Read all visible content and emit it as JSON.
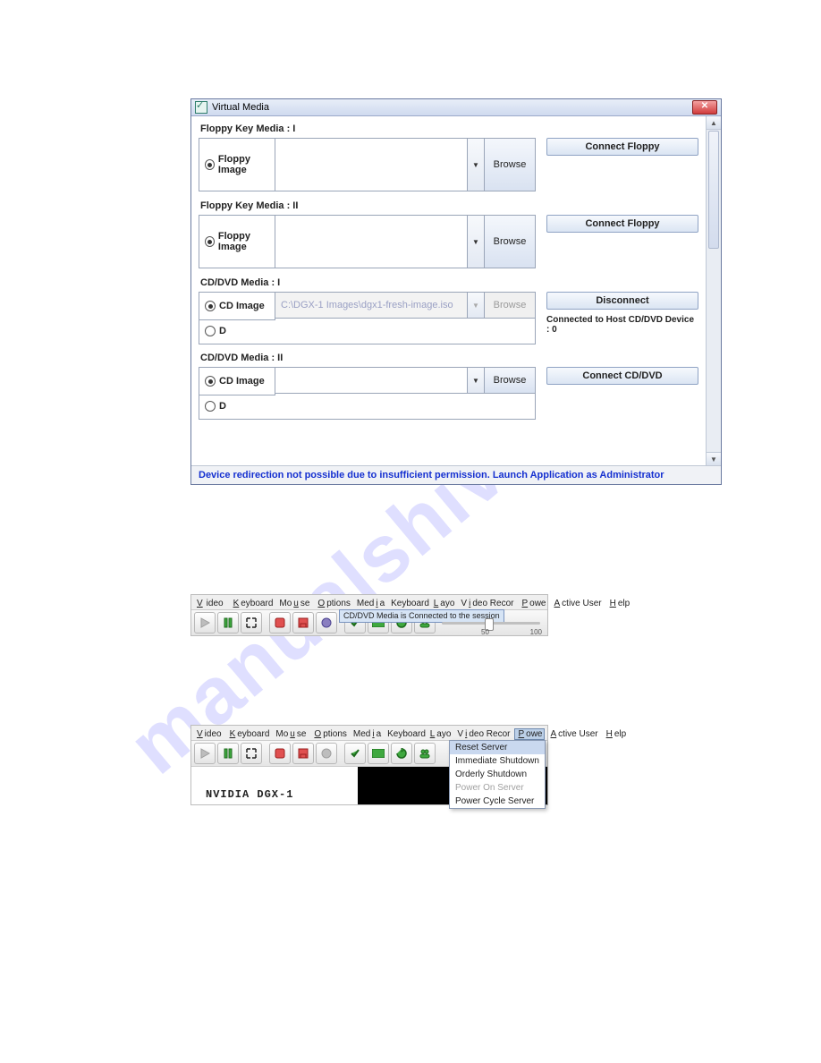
{
  "dialog": {
    "title": "Virtual Media",
    "footer": "Device redirection not possible due to insufficient permission. Launch Application as Administrator",
    "sections": {
      "floppy1": {
        "label": "Floppy Key Media : I",
        "radio_label": "Floppy Image",
        "browse": "Browse",
        "action": "Connect Floppy"
      },
      "floppy2": {
        "label": "Floppy Key Media : II",
        "radio_label": "Floppy Image",
        "browse": "Browse",
        "action": "Connect Floppy"
      },
      "cd1": {
        "label": "CD/DVD Media : I",
        "radio_label": "CD Image",
        "path": "C:\\DGX-1 Images\\dgx1-fresh-image.iso",
        "browse": "Browse",
        "d_label": "D",
        "action": "Disconnect",
        "status": "Connected to Host CD/DVD Device : 0"
      },
      "cd2": {
        "label": "CD/DVD Media : II",
        "radio_label": "CD Image",
        "browse": "Browse",
        "d_label": "D",
        "action": "Connect CD/DVD"
      }
    }
  },
  "menubar": {
    "items": [
      "Video",
      "Keyboard",
      "Mouse",
      "Options",
      "Media",
      "Keyboard Layo",
      "Video Recor",
      "Power",
      "Active User",
      "Help"
    ]
  },
  "tooltip1": "CD/DVD Media is Connected to the session",
  "slider": {
    "mid": "50",
    "max": "100"
  },
  "power_menu": {
    "items": [
      "Reset Server",
      "Immediate Shutdown",
      "Orderly Shutdown",
      "Power On Server",
      "Power Cycle Server"
    ],
    "selected": 0,
    "disabled": [
      3
    ]
  },
  "console_label": "NVIDIA DGX-1"
}
